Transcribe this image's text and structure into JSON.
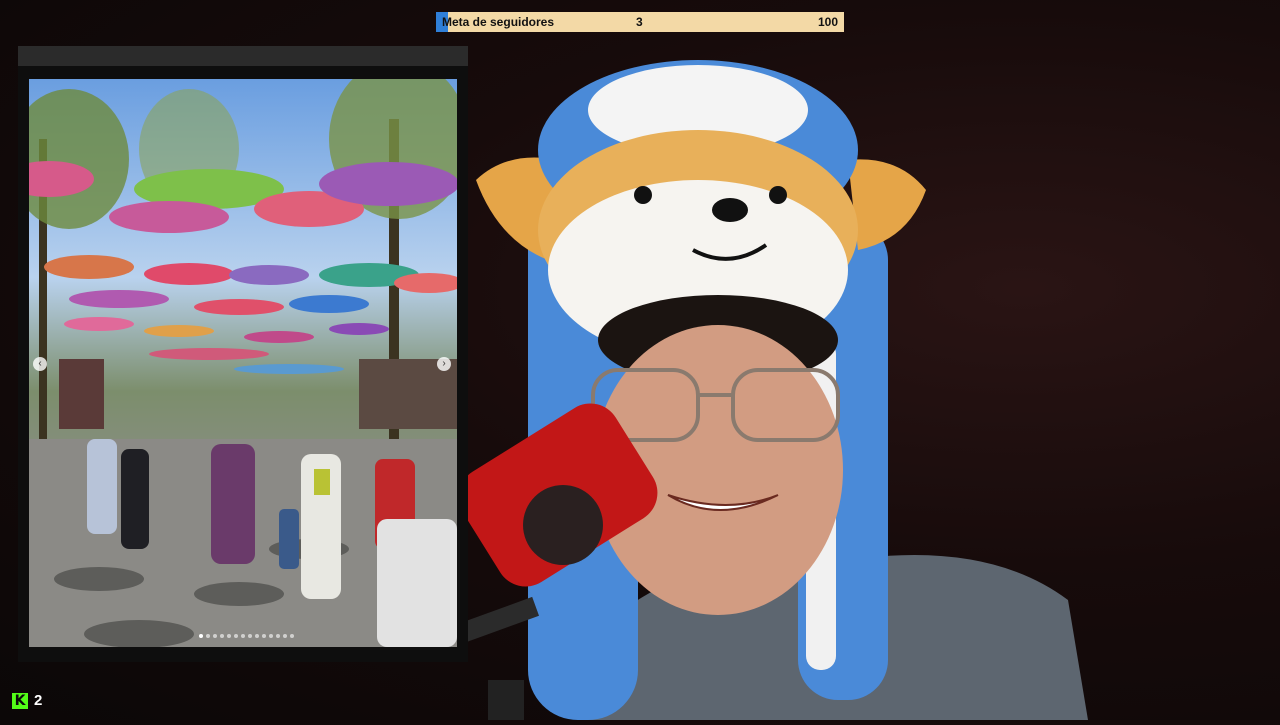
{
  "goal": {
    "label": "Meta de seguidores",
    "current": "3",
    "target": "100",
    "progress_fraction": 0.03,
    "fill_color": "#2f7fd8",
    "bar_color": "#f3d9a6"
  },
  "share": {
    "image_description_icon": "photo-carousel",
    "slide_count": 14,
    "active_slide": 1
  },
  "viewers": {
    "platform_icon": "kick-logo-icon",
    "logo_letter": "K",
    "count": "2",
    "logo_color": "#53fc18"
  }
}
